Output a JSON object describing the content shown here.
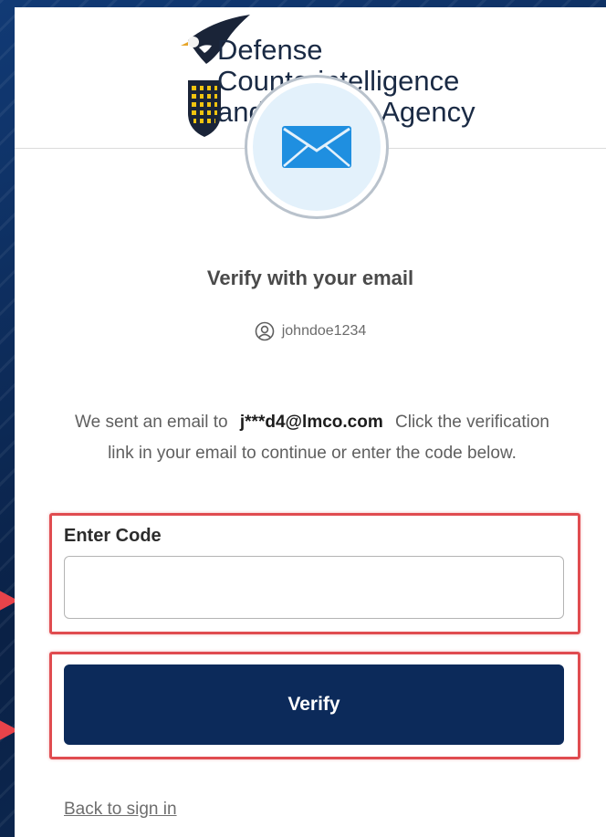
{
  "brand": {
    "line1": "Defense",
    "line2": "Counterintelligence",
    "line3": "and Security Agency"
  },
  "page": {
    "title": "Verify with your email",
    "username": "johndoe1234",
    "desc_prefix": "We sent an email to",
    "masked_email": "j***d4@lmco.com",
    "desc_suffix": "Click the verification link in your email to continue or enter the code below."
  },
  "form": {
    "code_label": "Enter Code",
    "code_value": "",
    "verify_label": "Verify",
    "back_link": "Back to sign in"
  },
  "icons": {
    "brand_logo": "eagle-shield-icon",
    "email": "envelope-icon",
    "user": "user-circle-icon",
    "callout": "red-arrow-icon"
  },
  "colors": {
    "primary": "#0c2a5a",
    "highlight": "#e04c50",
    "background": "#0d2a55",
    "icon_circle": "#e3f1fb"
  }
}
